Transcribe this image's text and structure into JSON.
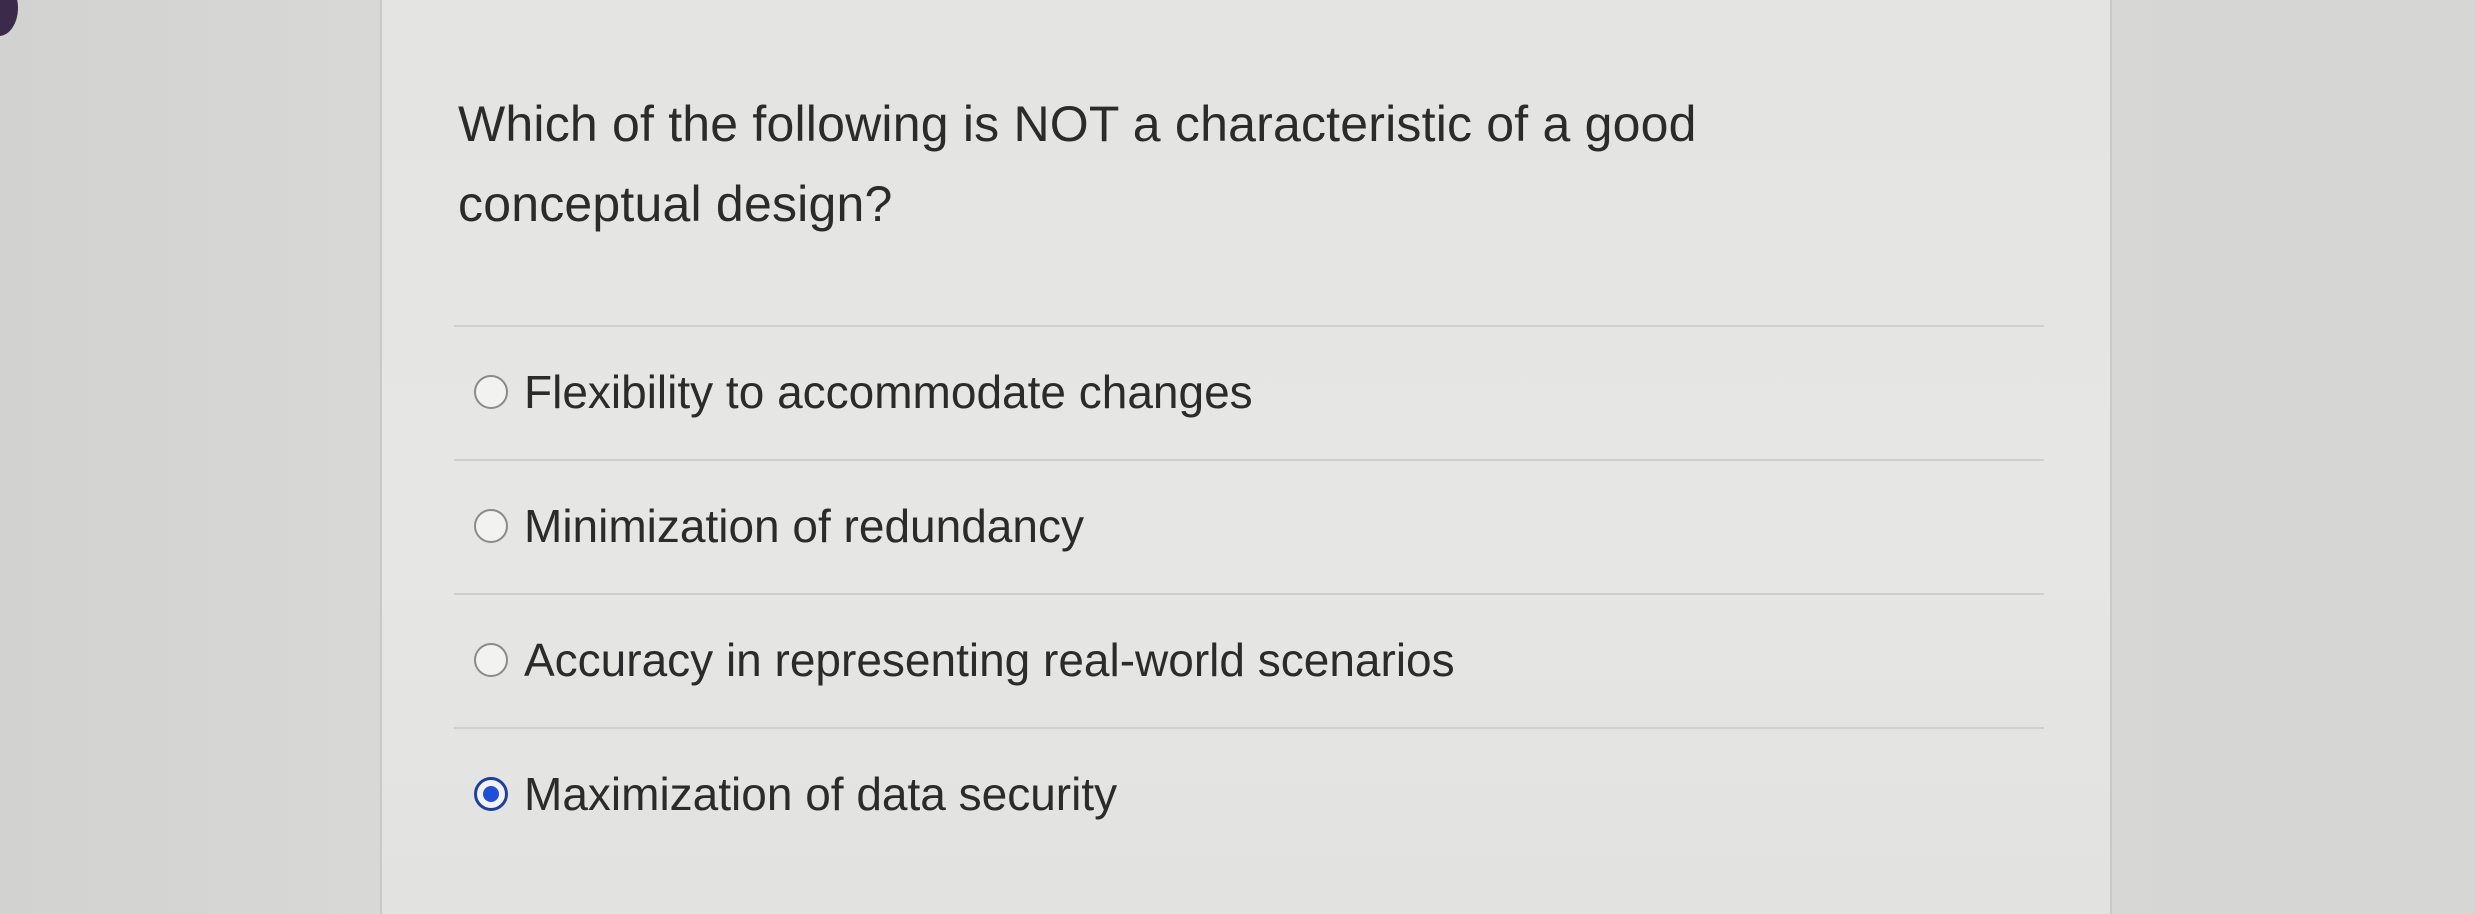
{
  "question": {
    "text": "Which of the following is NOT a characteristic of a good conceptual design?"
  },
  "options": [
    {
      "label": "Flexibility to accommodate changes",
      "selected": false
    },
    {
      "label": "Minimization of redundancy",
      "selected": false
    },
    {
      "label": "Accuracy in representing real-world scenarios",
      "selected": false
    },
    {
      "label": "Maximization of data security",
      "selected": true
    }
  ],
  "colors": {
    "selected_radio": "#1d4fd8",
    "text": "#2b2b2b",
    "card_background": "#e4e4e2"
  }
}
